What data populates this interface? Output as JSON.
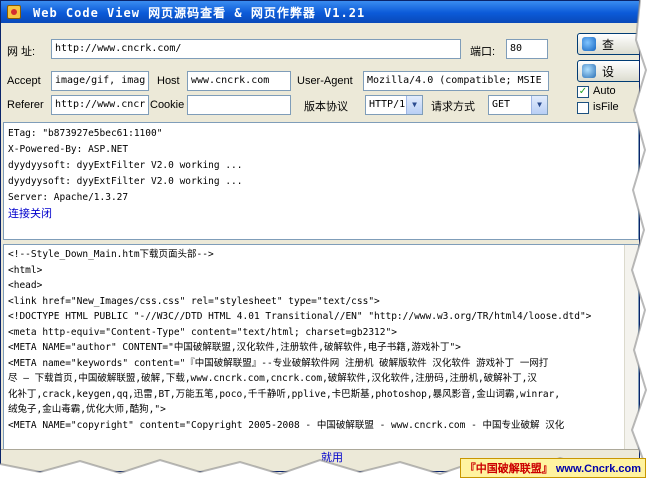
{
  "window": {
    "title": "Web Code View 网页源码查看 & 网页作弊器 V1.21"
  },
  "url_row": {
    "label": "网 址:",
    "value": "http://www.cncrk.com/",
    "port_label": "端口:",
    "port_value": "80"
  },
  "buttons": {
    "view_label": "查",
    "settings_label": "设"
  },
  "options": {
    "auto_label": "Auto",
    "auto_checked": true,
    "isfile_label": "isFile",
    "isfile_checked": false
  },
  "request": {
    "accept_label": "Accept",
    "accept_value": "image/gif, imag",
    "host_label": "Host",
    "host_value": "www.cncrk.com",
    "useragent_label": "User-Agent",
    "useragent_value": "Mozilla/4.0 (compatible; MSIE",
    "referer_label": "Referer",
    "referer_value": "http://www.cncr",
    "cookie_label": "Cookie",
    "cookie_value": "",
    "protocol_label": "版本协议",
    "protocol_value": "HTTP/1",
    "method_label": "请求方式",
    "method_value": "GET"
  },
  "response_headers": [
    "ETag: \"b873927e5bec61:1100\"",
    "X-Powered-By: ASP.NET",
    "dyydyysoft: dyyExtFilter V2.0 working ...",
    "dyydyysoft: dyyExtFilter V2.0 working ...",
    "Server: Apache/1.3.27"
  ],
  "connection_status": "连接关闭",
  "source_lines": [
    "<!--Style_Down_Main.htm下载页面头部-->",
    "<html>",
    "<head>",
    "<link href=\"New_Images/css.css\" rel=\"stylesheet\" type=\"text/css\">",
    "<!DOCTYPE HTML PUBLIC \"-//W3C//DTD HTML 4.01 Transitional//EN\" \"http://www.w3.org/TR/html4/loose.dtd\">",
    "<meta http-equiv=\"Content-Type\" content=\"text/html; charset=gb2312\">",
    "<META NAME=\"author\" CONTENT=\"中国破解联盟,汉化软件,注册软件,破解软件,电子书籍,游戏补丁\">",
    "<META name=\"keywords\" content=\"『中国破解联盟』--专业破解软件网 注册机 破解版软件 汉化软件 游戏补丁 一网打",
    "尽 — 下载首页,中国破解联盟,破解,下载,www.cncrk.com,cncrk.com,破解软件,汉化软件,注册码,注册机,破解补丁,汉",
    "化补丁,crack,keygen,qq,迅雷,BT,万能五笔,poco,千千静听,pplive,卡巴斯基,photoshop,暴风影音,金山词霸,winrar,",
    "绒兔子,金山毒霸,优化大师,酷狗,\">",
    "<META NAME=\"copyright\" content=\"Copyright 2005-2008 - 中国破解联盟 - www.cncrk.com - 中国专业破解 汉化"
  ],
  "status_bar": {
    "text": "就用",
    "brand_cn": "『中国破解联盟』",
    "brand_url": "www.Cncrk.com"
  }
}
